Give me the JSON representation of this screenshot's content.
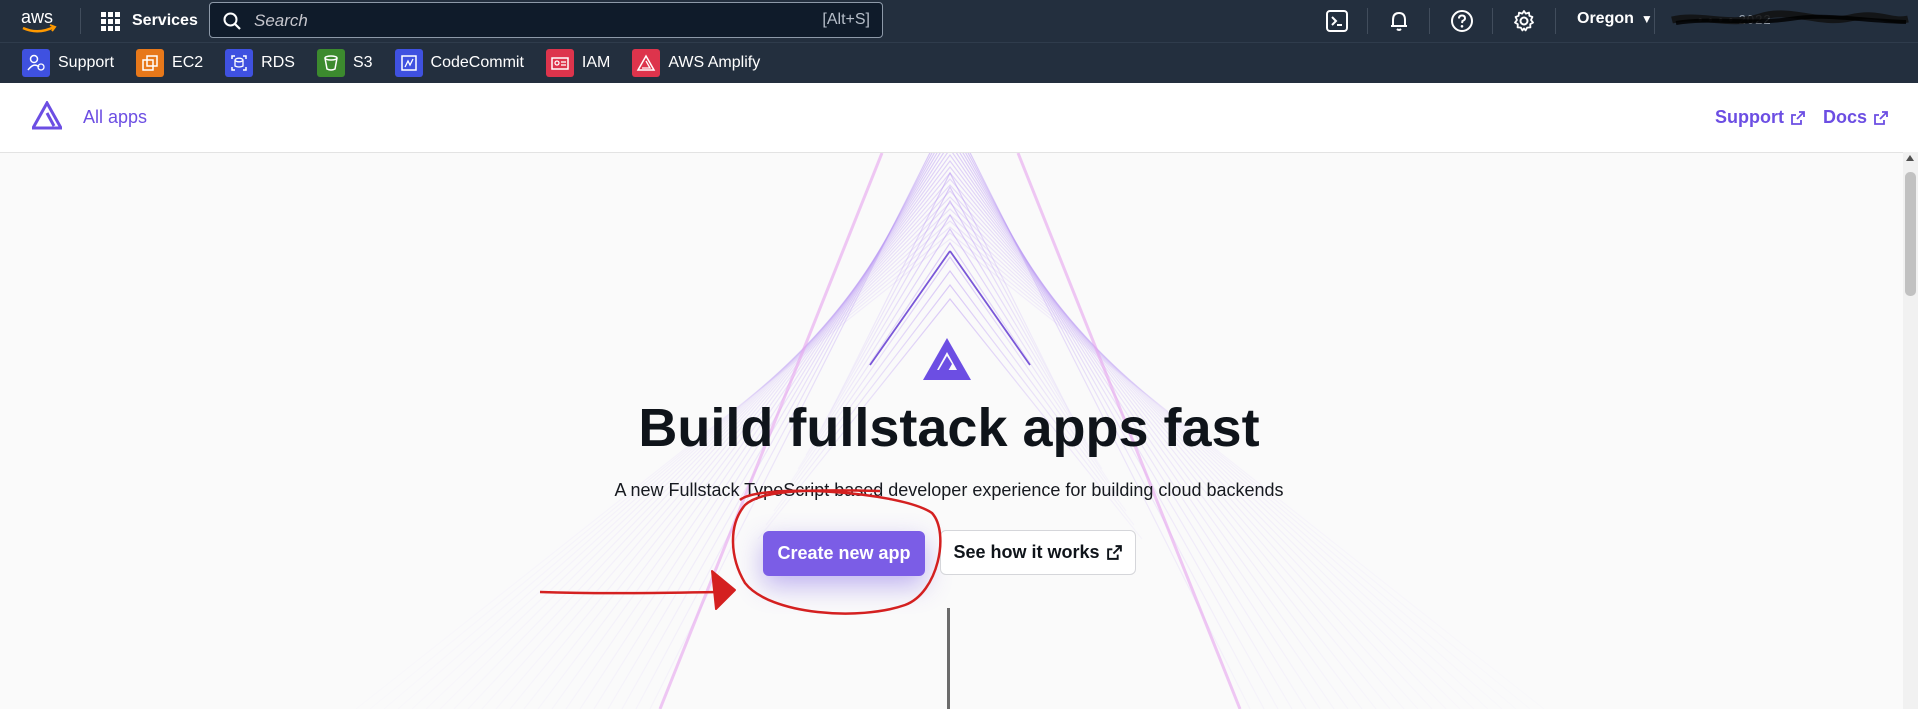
{
  "topnav": {
    "services_label": "Services",
    "search_placeholder": "Search",
    "search_shortcut": "[Alt+S]",
    "region": "Oregon",
    "account_obscured": "• • • • 2022"
  },
  "favorites": [
    {
      "label": "Support",
      "icon": "support-icon",
      "color": "#3f51e0"
    },
    {
      "label": "EC2",
      "icon": "ec2-icon",
      "color": "#e7781a"
    },
    {
      "label": "RDS",
      "icon": "rds-icon",
      "color": "#3f51e0"
    },
    {
      "label": "S3",
      "icon": "s3-icon",
      "color": "#3c8a2e"
    },
    {
      "label": "CodeCommit",
      "icon": "codecommit-icon",
      "color": "#3f51e0"
    },
    {
      "label": "IAM",
      "icon": "iam-icon",
      "color": "#dd344c"
    },
    {
      "label": "AWS Amplify",
      "icon": "amplify-icon",
      "color": "#dd344c"
    }
  ],
  "app_header": {
    "all_apps": "All apps",
    "support": "Support",
    "docs": "Docs"
  },
  "hero": {
    "title": "Build fullstack apps fast",
    "subtitle": "A new Fullstack TypeScript based developer experience for building cloud backends",
    "primary_button": "Create new app",
    "secondary_button": "See how it works"
  },
  "colors": {
    "nav_bg": "#232f3e",
    "accent": "#6c4ee3",
    "primary_button": "#7b5de6",
    "annotation": "#d42020"
  }
}
